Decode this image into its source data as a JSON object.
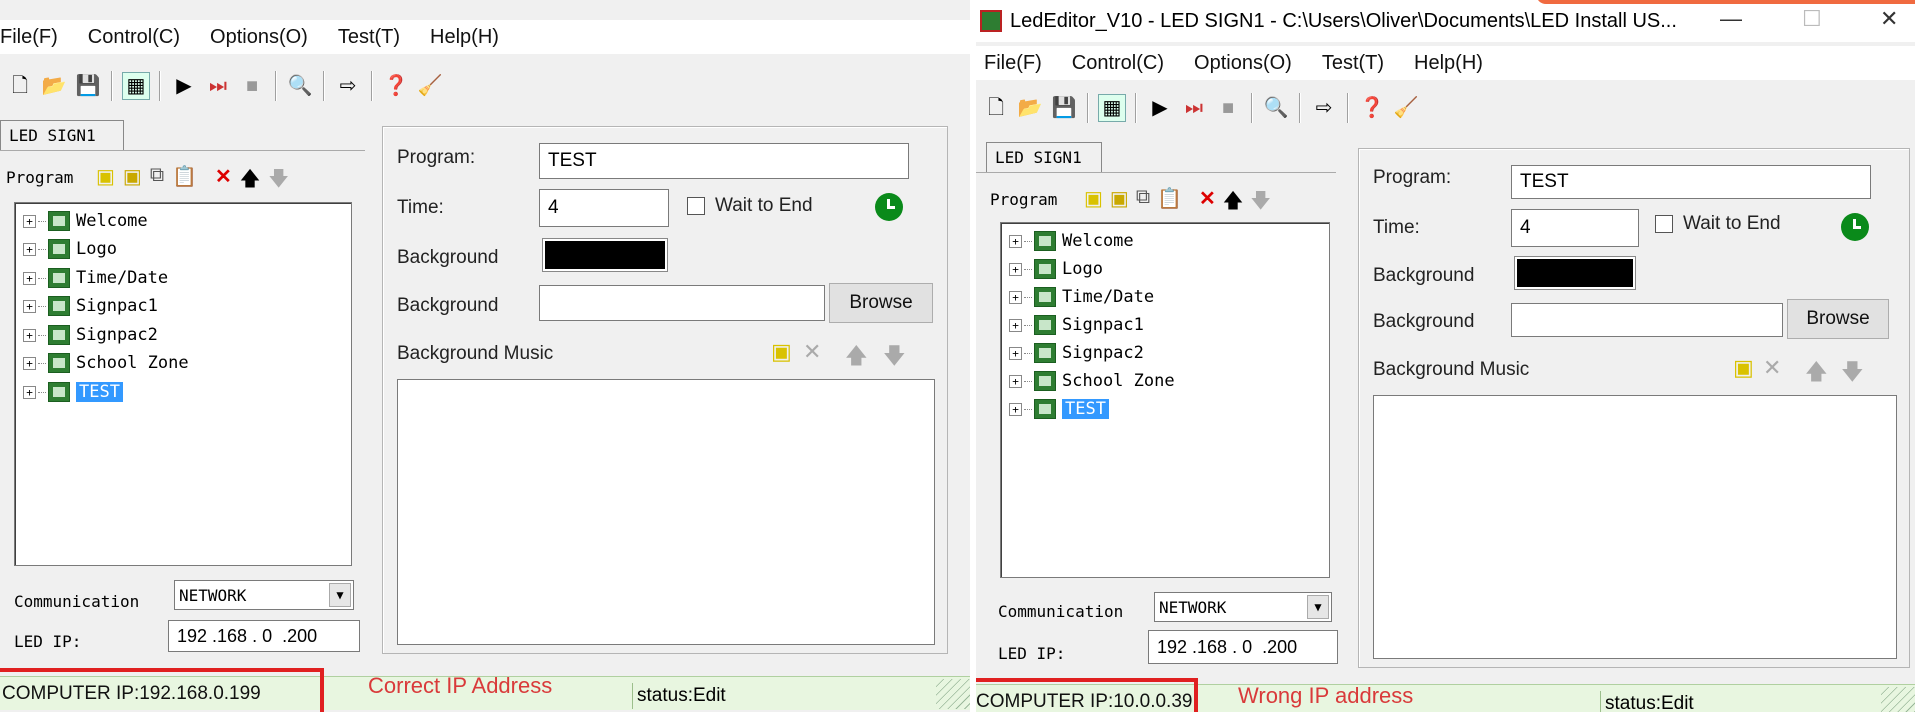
{
  "left_window": {
    "menu": [
      "File(F)",
      "Control(C)",
      "Options(O)",
      "Test(T)",
      "Help(H)"
    ],
    "tab": "LED SIGN1",
    "program_label": "Program",
    "tree_items": [
      "Welcome",
      "Logo",
      "Time/Date",
      "Signpac1",
      "Signpac2",
      "School Zone",
      "TEST"
    ],
    "form": {
      "program_label": "Program:",
      "program_value": "TEST",
      "time_label": "Time:",
      "time_value": "4",
      "wait_label": "Wait to End",
      "background_color_label": "Background",
      "background_image_label": "Background",
      "browse": "Browse",
      "music_label": "Background Music"
    },
    "communication_label": "Communication",
    "communication_value": "NETWORK",
    "led_ip_label": "LED IP:",
    "led_ip_value": "192 .168 . 0  .200",
    "status": {
      "computer_ip": "COMPUTER IP:192.168.0.199",
      "annotation": "Correct IP Address",
      "status_text": "status:Edit"
    }
  },
  "right_window": {
    "title": "LedEditor_V10 - LED SIGN1 - C:\\Users\\Oliver\\Documents\\LED Install US...",
    "menu": [
      "File(F)",
      "Control(C)",
      "Options(O)",
      "Test(T)",
      "Help(H)"
    ],
    "tab": "LED SIGN1",
    "program_label": "Program",
    "tree_items": [
      "Welcome",
      "Logo",
      "Time/Date",
      "Signpac1",
      "Signpac2",
      "School Zone",
      "TEST"
    ],
    "form": {
      "program_label": "Program:",
      "program_value": "TEST",
      "time_label": "Time:",
      "time_value": "4",
      "wait_label": "Wait to End",
      "background_color_label": "Background",
      "background_image_label": "Background",
      "browse": "Browse",
      "music_label": "Background Music"
    },
    "communication_label": "Communication",
    "communication_value": "NETWORK",
    "led_ip_label": "LED IP:",
    "led_ip_value": "192 .168 . 0  .200",
    "status": {
      "computer_ip": "COMPUTER IP:10.0.0.39",
      "annotation": "Wrong IP address",
      "status_text": "status:Edit"
    }
  },
  "colors": {
    "annotation_red": "#e02020",
    "status_green": "#e8f6e0",
    "selection_blue": "#3399ff"
  }
}
